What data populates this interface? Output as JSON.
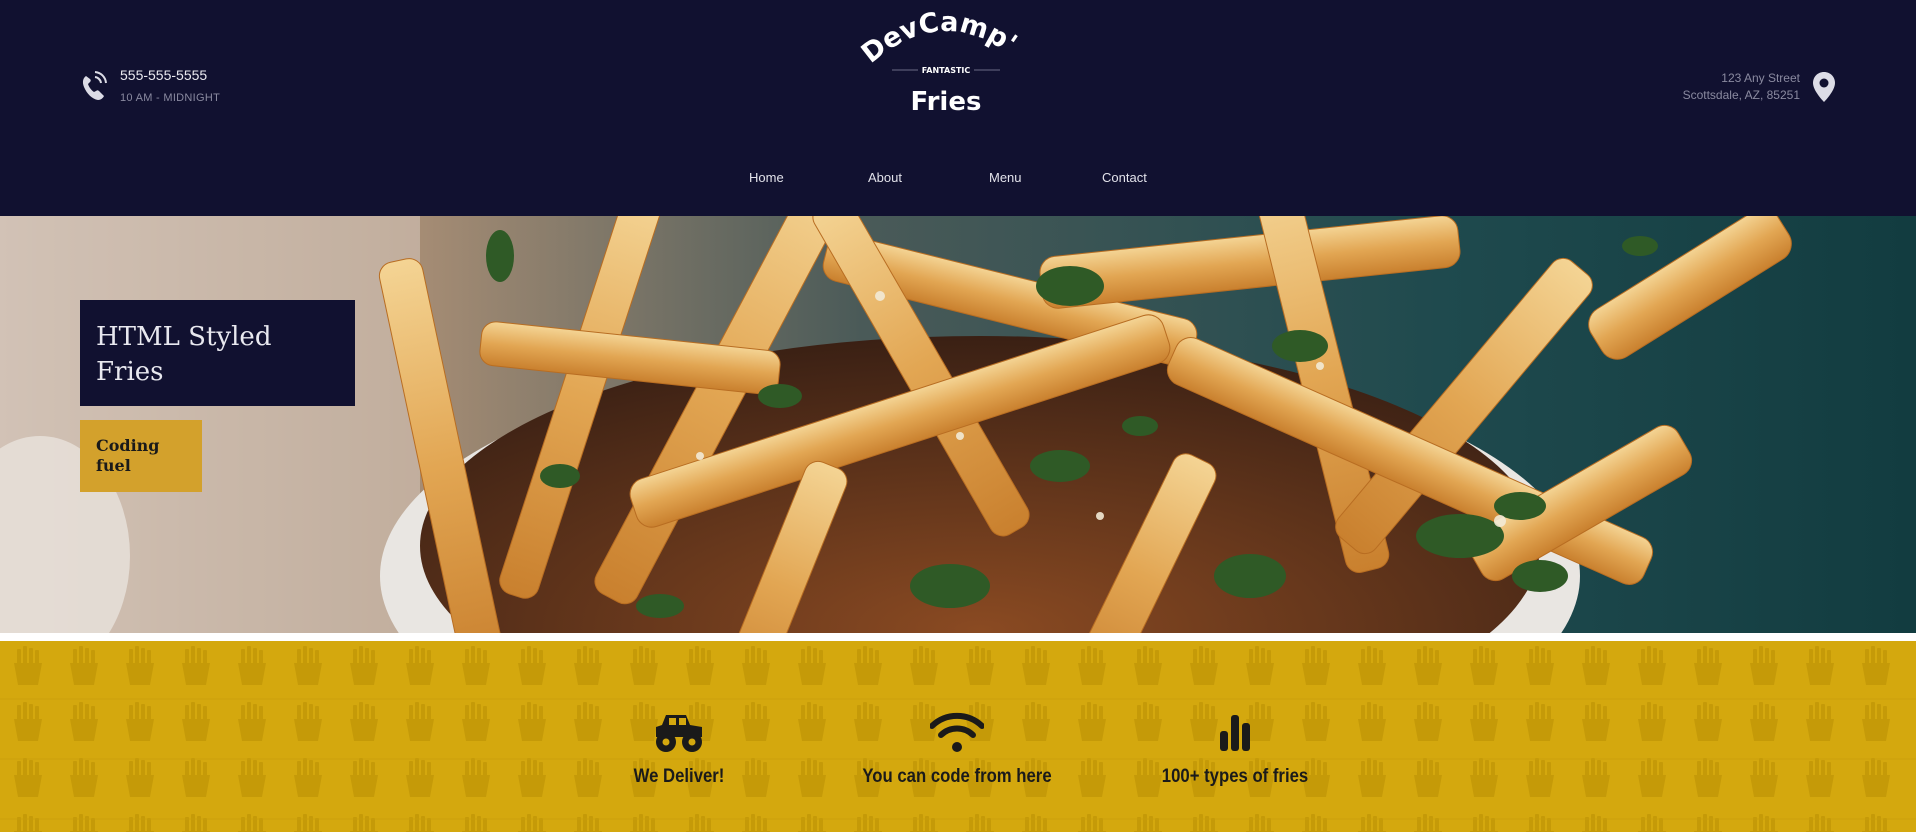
{
  "header": {
    "phone": "555-555-5555",
    "hours": "10 AM - MIDNIGHT",
    "address_line1": "123 Any Street",
    "address_line2": "Scottsdale, AZ, 85251",
    "logo": {
      "name": "DevCamp's",
      "tagline": "FANTASTIC",
      "word": "Fries"
    },
    "nav": [
      "Home",
      "About",
      "Menu",
      "Contact"
    ]
  },
  "hero": {
    "title": "HTML Styled Fries",
    "subtitle": "Coding fuel"
  },
  "features": [
    {
      "icon": "monster-truck-icon",
      "label": "We Deliver!"
    },
    {
      "icon": "wifi-icon",
      "label": "You can code from here"
    },
    {
      "icon": "bar-chart-icon",
      "label": "100+ types of fries"
    }
  ],
  "colors": {
    "navy": "#111130",
    "gold": "#d3a12c",
    "mustard": "#d4a80e"
  }
}
